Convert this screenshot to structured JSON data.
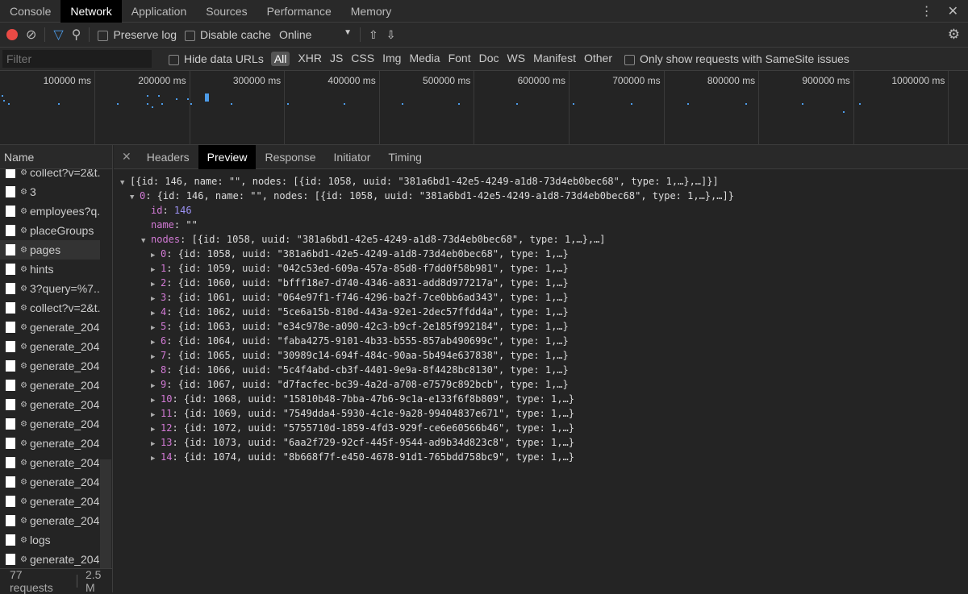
{
  "tabs": [
    "Console",
    "Network",
    "Application",
    "Sources",
    "Performance",
    "Memory"
  ],
  "toolbar": {
    "preserve_log": "Preserve log",
    "disable_cache": "Disable cache",
    "throttle": "Online"
  },
  "filterbar": {
    "placeholder": "Filter",
    "hide_data_urls": "Hide data URLs",
    "types": [
      "All",
      "XHR",
      "JS",
      "CSS",
      "Img",
      "Media",
      "Font",
      "Doc",
      "WS",
      "Manifest",
      "Other"
    ],
    "samesite": "Only show requests with SameSite issues"
  },
  "overview": {
    "ticks": [
      "100000 ms",
      "200000 ms",
      "300000 ms",
      "400000 ms",
      "500000 ms",
      "600000 ms",
      "700000 ms",
      "800000 ms",
      "900000 ms",
      "1000000 ms"
    ]
  },
  "requests": {
    "header": "Name",
    "items": [
      "collect?v=2&t...",
      "3",
      "employees?q...",
      "placeGroups",
      "pages",
      "hints",
      "3?query=%7...",
      "collect?v=2&t...",
      "generate_204",
      "generate_204",
      "generate_204",
      "generate_204",
      "generate_204",
      "generate_204",
      "generate_204",
      "generate_204",
      "generate_204",
      "generate_204",
      "generate_204",
      "logs",
      "generate_204"
    ],
    "selected": "pages",
    "count": "77 requests",
    "size": "2.5 M"
  },
  "panel": {
    "tabs": [
      "Headers",
      "Preview",
      "Response",
      "Initiator",
      "Timing"
    ],
    "active": "Preview"
  },
  "preview": {
    "root": "[{id: 146, name: \"\", nodes: [{id: 1058, uuid: \"381a6bd1-42e5-4249-a1d8-73d4eb0bec68\", type: 1,…},…]}]",
    "item0_key": "0",
    "item0": ": {id: 146, name: \"\", nodes: [{id: 1058, uuid: \"381a6bd1-42e5-4249-a1d8-73d4eb0bec68\", type: 1,…},…]}",
    "id_key": "id",
    "id_val": "146",
    "name_key": "name",
    "name_val": "\"\"",
    "nodes_key": "nodes",
    "nodes_summary": ": [{id: 1058, uuid: \"381a6bd1-42e5-4249-a1d8-73d4eb0bec68\", type: 1,…},…]",
    "nodes": [
      "{id: 1058, uuid: \"381a6bd1-42e5-4249-a1d8-73d4eb0bec68\", type: 1,…}",
      "{id: 1059, uuid: \"042c53ed-609a-457a-85d8-f7dd0f58b981\", type: 1,…}",
      "{id: 1060, uuid: \"bfff18e7-d740-4346-a831-add8d977217a\", type: 1,…}",
      "{id: 1061, uuid: \"064e97f1-f746-4296-ba2f-7ce0bb6ad343\", type: 1,…}",
      "{id: 1062, uuid: \"5ce6a15b-810d-443a-92e1-2dec57ffdd4a\", type: 1,…}",
      "{id: 1063, uuid: \"e34c978e-a090-42c3-b9cf-2e185f992184\", type: 1,…}",
      "{id: 1064, uuid: \"faba4275-9101-4b33-b555-857ab490699c\", type: 1,…}",
      "{id: 1065, uuid: \"30989c14-694f-484c-90aa-5b494e637838\", type: 1,…}",
      "{id: 1066, uuid: \"5c4f4abd-cb3f-4401-9e9a-8f4428bc8130\", type: 1,…}",
      "{id: 1067, uuid: \"d7facfec-bc39-4a2d-a708-e7579c892bcb\", type: 1,…}",
      "{id: 1068, uuid: \"15810b48-7bba-47b6-9c1a-e133f6f8b809\", type: 1,…}",
      "{id: 1069, uuid: \"7549dda4-5930-4c1e-9a28-99404837e671\", type: 1,…}",
      "{id: 1072, uuid: \"5755710d-1859-4fd3-929f-ce6e60566b46\", type: 1,…}",
      "{id: 1073, uuid: \"6aa2f729-92cf-445f-9544-ad9b34d823c8\", type: 1,…}",
      "{id: 1074, uuid: \"8b668f7f-e450-4678-91d1-765bdd758bc9\", type: 1,…}"
    ]
  },
  "colors": {
    "record": "#e94a45",
    "accent": "#4c9be8",
    "key": "#d27ad5",
    "number": "#9d93f6"
  }
}
